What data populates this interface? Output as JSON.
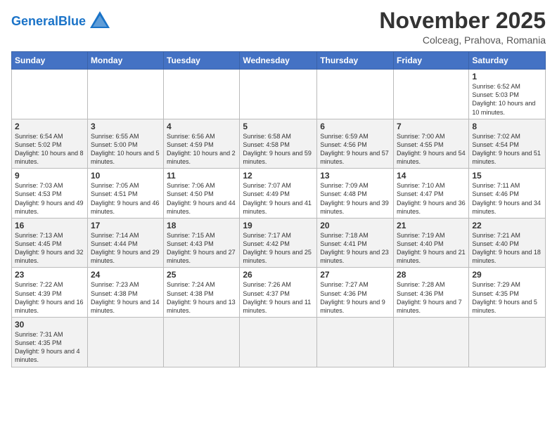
{
  "logo": {
    "text_general": "General",
    "text_blue": "Blue"
  },
  "header": {
    "title": "November 2025",
    "subtitle": "Colceag, Prahova, Romania"
  },
  "weekdays": [
    "Sunday",
    "Monday",
    "Tuesday",
    "Wednesday",
    "Thursday",
    "Friday",
    "Saturday"
  ],
  "weeks": [
    [
      {
        "day": "",
        "info": ""
      },
      {
        "day": "",
        "info": ""
      },
      {
        "day": "",
        "info": ""
      },
      {
        "day": "",
        "info": ""
      },
      {
        "day": "",
        "info": ""
      },
      {
        "day": "",
        "info": ""
      },
      {
        "day": "1",
        "info": "Sunrise: 6:52 AM\nSunset: 5:03 PM\nDaylight: 10 hours and 10 minutes."
      }
    ],
    [
      {
        "day": "2",
        "info": "Sunrise: 6:54 AM\nSunset: 5:02 PM\nDaylight: 10 hours and 8 minutes."
      },
      {
        "day": "3",
        "info": "Sunrise: 6:55 AM\nSunset: 5:00 PM\nDaylight: 10 hours and 5 minutes."
      },
      {
        "day": "4",
        "info": "Sunrise: 6:56 AM\nSunset: 4:59 PM\nDaylight: 10 hours and 2 minutes."
      },
      {
        "day": "5",
        "info": "Sunrise: 6:58 AM\nSunset: 4:58 PM\nDaylight: 9 hours and 59 minutes."
      },
      {
        "day": "6",
        "info": "Sunrise: 6:59 AM\nSunset: 4:56 PM\nDaylight: 9 hours and 57 minutes."
      },
      {
        "day": "7",
        "info": "Sunrise: 7:00 AM\nSunset: 4:55 PM\nDaylight: 9 hours and 54 minutes."
      },
      {
        "day": "8",
        "info": "Sunrise: 7:02 AM\nSunset: 4:54 PM\nDaylight: 9 hours and 51 minutes."
      }
    ],
    [
      {
        "day": "9",
        "info": "Sunrise: 7:03 AM\nSunset: 4:53 PM\nDaylight: 9 hours and 49 minutes."
      },
      {
        "day": "10",
        "info": "Sunrise: 7:05 AM\nSunset: 4:51 PM\nDaylight: 9 hours and 46 minutes."
      },
      {
        "day": "11",
        "info": "Sunrise: 7:06 AM\nSunset: 4:50 PM\nDaylight: 9 hours and 44 minutes."
      },
      {
        "day": "12",
        "info": "Sunrise: 7:07 AM\nSunset: 4:49 PM\nDaylight: 9 hours and 41 minutes."
      },
      {
        "day": "13",
        "info": "Sunrise: 7:09 AM\nSunset: 4:48 PM\nDaylight: 9 hours and 39 minutes."
      },
      {
        "day": "14",
        "info": "Sunrise: 7:10 AM\nSunset: 4:47 PM\nDaylight: 9 hours and 36 minutes."
      },
      {
        "day": "15",
        "info": "Sunrise: 7:11 AM\nSunset: 4:46 PM\nDaylight: 9 hours and 34 minutes."
      }
    ],
    [
      {
        "day": "16",
        "info": "Sunrise: 7:13 AM\nSunset: 4:45 PM\nDaylight: 9 hours and 32 minutes."
      },
      {
        "day": "17",
        "info": "Sunrise: 7:14 AM\nSunset: 4:44 PM\nDaylight: 9 hours and 29 minutes."
      },
      {
        "day": "18",
        "info": "Sunrise: 7:15 AM\nSunset: 4:43 PM\nDaylight: 9 hours and 27 minutes."
      },
      {
        "day": "19",
        "info": "Sunrise: 7:17 AM\nSunset: 4:42 PM\nDaylight: 9 hours and 25 minutes."
      },
      {
        "day": "20",
        "info": "Sunrise: 7:18 AM\nSunset: 4:41 PM\nDaylight: 9 hours and 23 minutes."
      },
      {
        "day": "21",
        "info": "Sunrise: 7:19 AM\nSunset: 4:40 PM\nDaylight: 9 hours and 21 minutes."
      },
      {
        "day": "22",
        "info": "Sunrise: 7:21 AM\nSunset: 4:40 PM\nDaylight: 9 hours and 18 minutes."
      }
    ],
    [
      {
        "day": "23",
        "info": "Sunrise: 7:22 AM\nSunset: 4:39 PM\nDaylight: 9 hours and 16 minutes."
      },
      {
        "day": "24",
        "info": "Sunrise: 7:23 AM\nSunset: 4:38 PM\nDaylight: 9 hours and 14 minutes."
      },
      {
        "day": "25",
        "info": "Sunrise: 7:24 AM\nSunset: 4:38 PM\nDaylight: 9 hours and 13 minutes."
      },
      {
        "day": "26",
        "info": "Sunrise: 7:26 AM\nSunset: 4:37 PM\nDaylight: 9 hours and 11 minutes."
      },
      {
        "day": "27",
        "info": "Sunrise: 7:27 AM\nSunset: 4:36 PM\nDaylight: 9 hours and 9 minutes."
      },
      {
        "day": "28",
        "info": "Sunrise: 7:28 AM\nSunset: 4:36 PM\nDaylight: 9 hours and 7 minutes."
      },
      {
        "day": "29",
        "info": "Sunrise: 7:29 AM\nSunset: 4:35 PM\nDaylight: 9 hours and 5 minutes."
      }
    ],
    [
      {
        "day": "30",
        "info": "Sunrise: 7:31 AM\nSunset: 4:35 PM\nDaylight: 9 hours and 4 minutes."
      },
      {
        "day": "",
        "info": ""
      },
      {
        "day": "",
        "info": ""
      },
      {
        "day": "",
        "info": ""
      },
      {
        "day": "",
        "info": ""
      },
      {
        "day": "",
        "info": ""
      },
      {
        "day": "",
        "info": ""
      }
    ]
  ]
}
